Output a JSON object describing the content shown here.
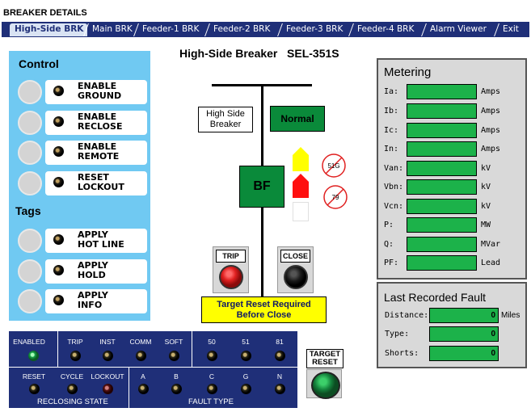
{
  "window": {
    "title": "BREAKER DETAILS"
  },
  "tabs": [
    {
      "label": "High-Side BRK",
      "active": true
    },
    {
      "label": "Main BRK"
    },
    {
      "label": "Feeder-1 BRK"
    },
    {
      "label": "Feeder-2 BRK"
    },
    {
      "label": "Feeder-3 BRK"
    },
    {
      "label": "Feeder-4 BRK"
    },
    {
      "label": "Alarm Viewer"
    },
    {
      "label": "Exit"
    }
  ],
  "control": {
    "heading": "Control",
    "buttons": [
      {
        "label": "ENABLE\nGROUND"
      },
      {
        "label": "ENABLE\nRECLOSE"
      },
      {
        "label": "ENABLE\nREMOTE"
      },
      {
        "label": "RESET\nLOCKOUT"
      }
    ],
    "tags_heading": "Tags",
    "tags": [
      {
        "label": "APPLY\nHOT LINE"
      },
      {
        "label": "APPLY\nHOLD"
      },
      {
        "label": "APPLY\nINFO"
      }
    ]
  },
  "diagram": {
    "title": "High-Side Breaker   SEL-351S",
    "breaker_label": "High Side\nBreaker",
    "status": "Normal",
    "breaker_symbol": "BF",
    "relay_51g": "51G",
    "relay_79": "79",
    "trip_label": "TRIP",
    "close_label": "CLOSE",
    "warning": "Target Reset Required\nBefore Close",
    "colors": {
      "breaker_green": "#0a8a3a",
      "trip_red": "#e02020",
      "warning_yellow": "#ffff00"
    }
  },
  "metering": {
    "heading": "Metering",
    "rows": [
      {
        "name": "Ia:",
        "unit": "Amps"
      },
      {
        "name": "Ib:",
        "unit": "Amps"
      },
      {
        "name": "Ic:",
        "unit": "Amps"
      },
      {
        "name": "In:",
        "unit": "Amps"
      },
      {
        "name": "Van:",
        "unit": "kV"
      },
      {
        "name": "Vbn:",
        "unit": "kV"
      },
      {
        "name": "Vcn:",
        "unit": "kV"
      },
      {
        "name": "P:",
        "unit": "MW"
      },
      {
        "name": "Q:",
        "unit": "MVar"
      },
      {
        "name": "PF:",
        "unit": "Lead"
      }
    ]
  },
  "fault": {
    "heading": "Last Recorded Fault",
    "rows": [
      {
        "name": "Distance:",
        "value": "0",
        "unit": "Miles"
      },
      {
        "name": "Type:",
        "value": "0",
        "unit": ""
      },
      {
        "name": "Shorts:",
        "value": "0",
        "unit": ""
      }
    ]
  },
  "status_panel": {
    "top": [
      {
        "label": "ENABLED",
        "state": "green"
      },
      {
        "label": "TRIP",
        "state": "off"
      },
      {
        "label": "INST",
        "state": "off"
      },
      {
        "label": "COMM",
        "state": "off"
      },
      {
        "label": "SOFT",
        "state": "off"
      },
      {
        "label": "50",
        "state": "off"
      },
      {
        "label": "51",
        "state": "off"
      },
      {
        "label": "81",
        "state": "off"
      }
    ],
    "bottom": [
      {
        "label": "RESET",
        "state": "off"
      },
      {
        "label": "CYCLE",
        "state": "off"
      },
      {
        "label": "LOCKOUT",
        "state": "red"
      },
      {
        "label": "A",
        "state": "off"
      },
      {
        "label": "B",
        "state": "off"
      },
      {
        "label": "C",
        "state": "off"
      },
      {
        "label": "G",
        "state": "off"
      },
      {
        "label": "N",
        "state": "off"
      }
    ],
    "reclosing_state": "RECLOSING STATE",
    "fault_type": "FAULT TYPE"
  },
  "target_reset": {
    "label": "TARGET\nRESET"
  }
}
